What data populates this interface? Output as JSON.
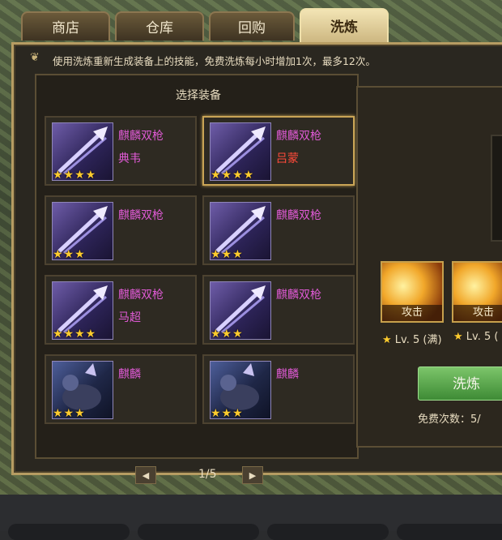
{
  "tabs": [
    {
      "label": "商店",
      "active": false
    },
    {
      "label": "仓库",
      "active": false
    },
    {
      "label": "回购",
      "active": false
    },
    {
      "label": "洗炼",
      "active": true
    }
  ],
  "info_text": "使用洗炼重新生成装备上的技能，免费洗炼每小时增加1次，最多12次。",
  "panel_title": "选择装备",
  "items": [
    {
      "name": "麒麟双枪",
      "general": "典韦",
      "stars": "★★★★",
      "kind": "weapon",
      "selected": false
    },
    {
      "name": "麒麟双枪",
      "general": "吕蒙",
      "stars": "★★★★",
      "kind": "weapon",
      "selected": true
    },
    {
      "name": "麒麟双枪",
      "general": "",
      "stars": "★★★",
      "kind": "weapon",
      "selected": false
    },
    {
      "name": "麒麟双枪",
      "general": "",
      "stars": "★★★",
      "kind": "weapon",
      "selected": false
    },
    {
      "name": "麒麟双枪",
      "general": "马超",
      "stars": "★★★★",
      "kind": "weapon",
      "selected": false
    },
    {
      "name": "麒麟双枪",
      "general": "",
      "stars": "★★★",
      "kind": "weapon",
      "selected": false
    },
    {
      "name": "麒麟",
      "general": "",
      "stars": "★★★",
      "kind": "mount",
      "selected": false
    },
    {
      "name": "麒麟",
      "general": "",
      "stars": "★★★",
      "kind": "mount",
      "selected": false
    }
  ],
  "pager": {
    "text": "1/5",
    "prev": "◀",
    "next": "▶"
  },
  "skills": [
    {
      "label": "攻击",
      "level": "Lv. 5 (满)"
    },
    {
      "label": "攻击",
      "level": "Lv. 5 ("
    }
  ],
  "wash_button": "洗炼",
  "free_count": "免费次数：5/",
  "colors": {
    "accent_gold": "#c9a456",
    "item_name": "#e05ad6",
    "general_red": "#ff4a3a",
    "star": "#ffcc2e",
    "button_green": "#5aa84a"
  }
}
